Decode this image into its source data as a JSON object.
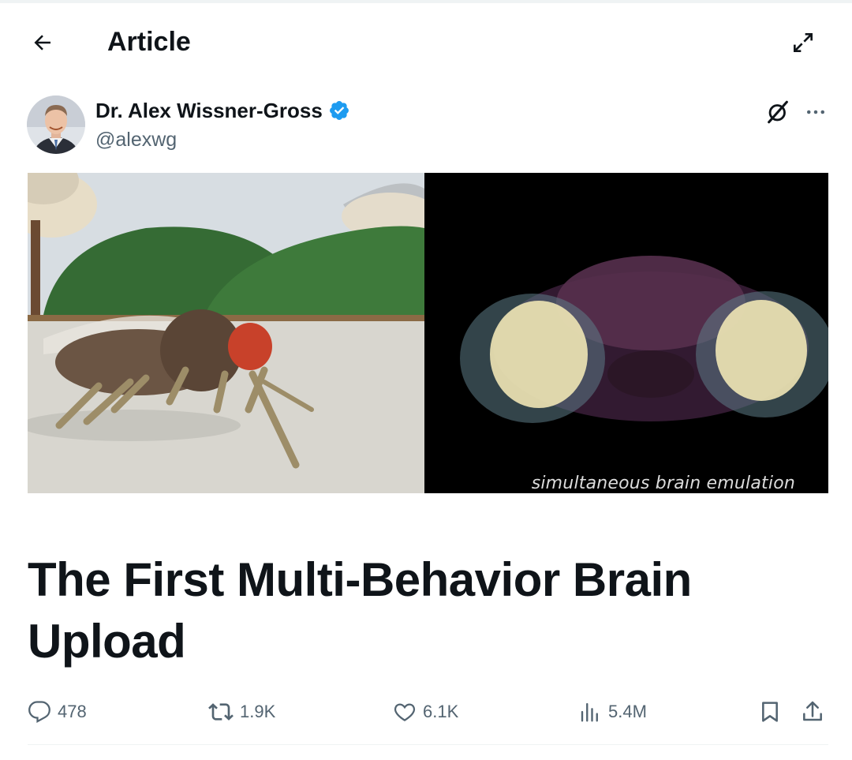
{
  "header": {
    "title": "Article",
    "back_icon": "arrow-left-icon",
    "expand_icon": "expand-icon"
  },
  "author": {
    "name": "Dr. Alex Wissner-Gross",
    "handle": "@alexwg",
    "verified": true,
    "verified_color": "#1d9bf0"
  },
  "media": {
    "caption": "simultaneous brain emulation"
  },
  "article": {
    "title": "The First Multi-Behavior Brain Upload"
  },
  "actions": {
    "replies": "478",
    "reposts": "1.9K",
    "likes": "6.1K",
    "views": "5.4M"
  },
  "colors": {
    "text_primary": "#0f1419",
    "text_secondary": "#536471",
    "accent": "#1d9bf0"
  }
}
